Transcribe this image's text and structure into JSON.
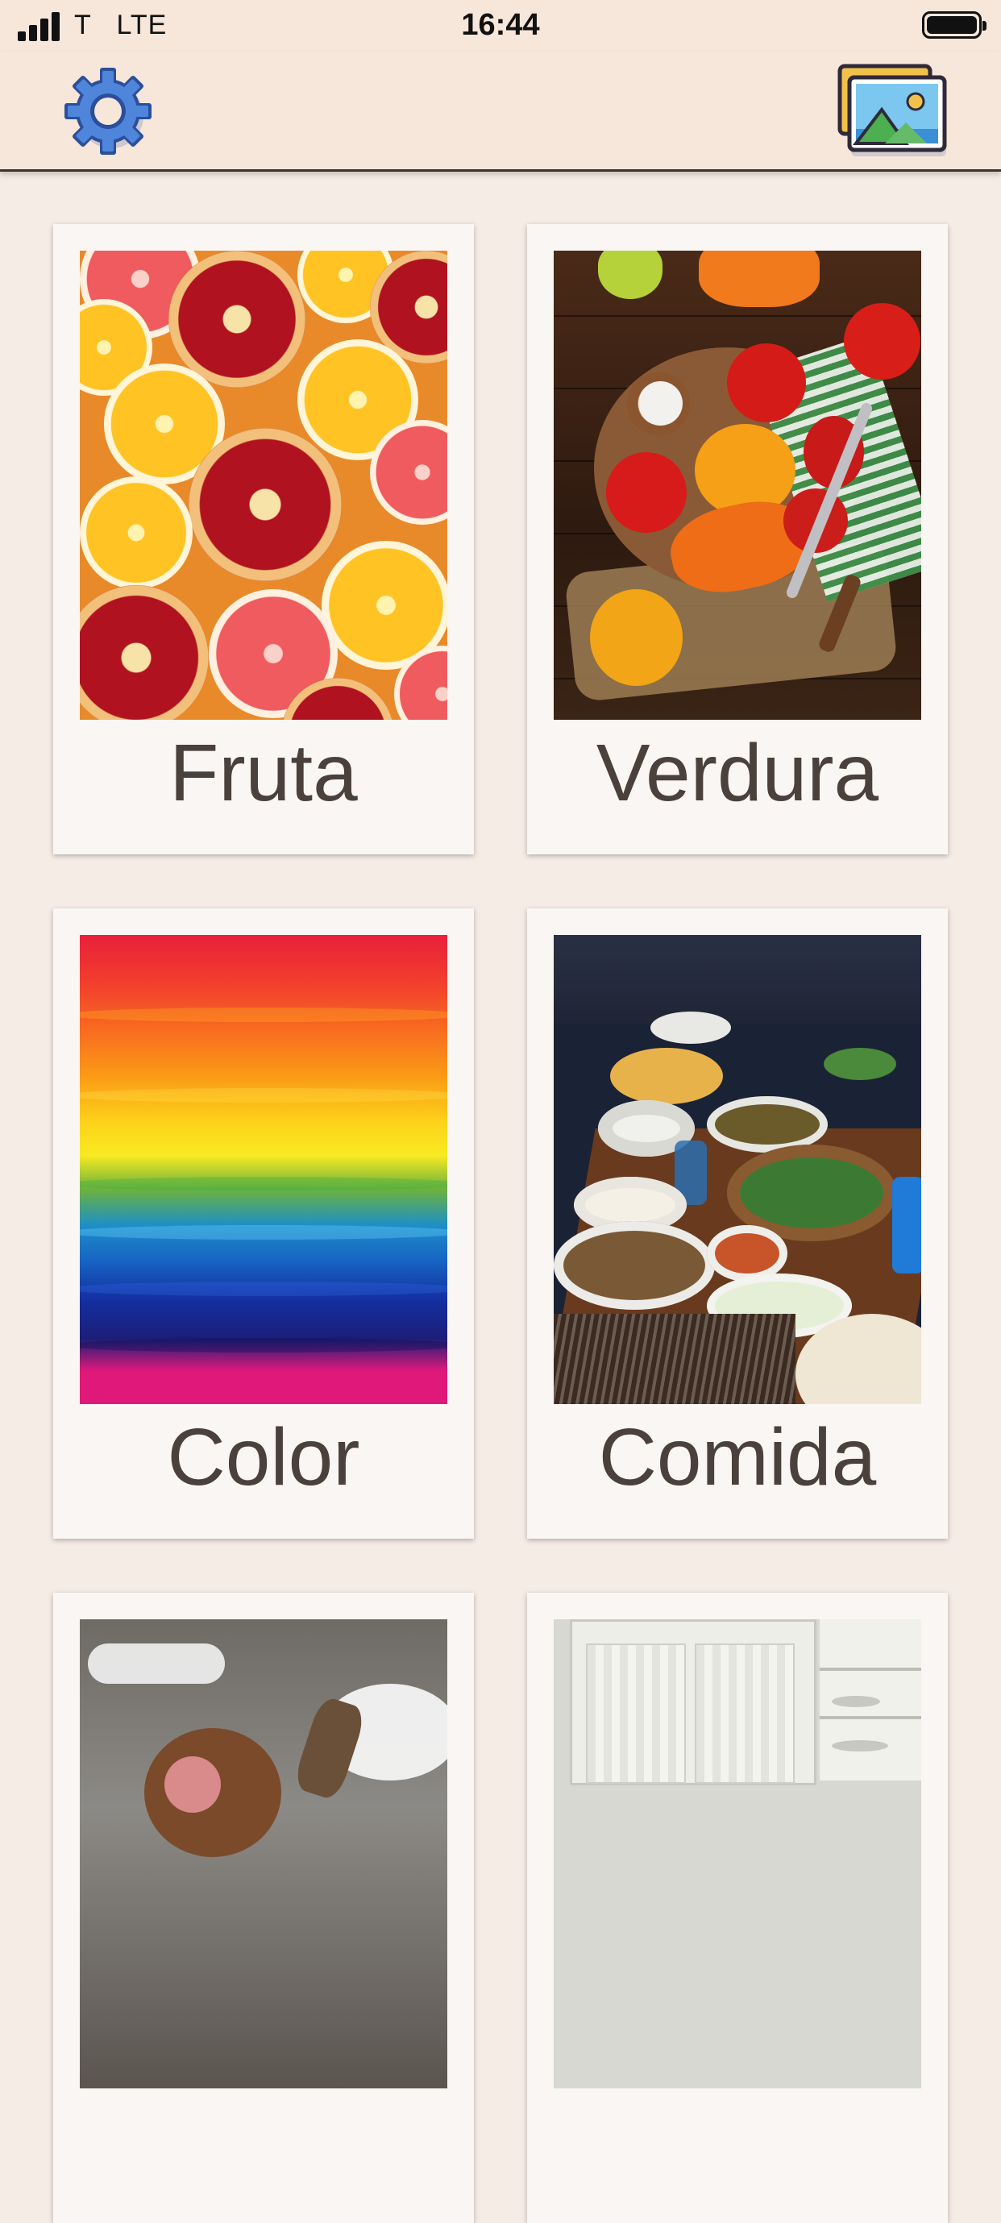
{
  "status_bar": {
    "carrier": "T   LTE",
    "time": "16:44"
  },
  "toolbar": {
    "settings_icon": "gear-icon",
    "gallery_icon": "photo-gallery-icon"
  },
  "categories": [
    {
      "label": "Fruta",
      "image": "citrus-and-pomegranate-photo"
    },
    {
      "label": "Verdura",
      "image": "peppers-and-tomatoes-photo"
    },
    {
      "label": "Color",
      "image": "rainbow-paint-photo"
    },
    {
      "label": "Comida",
      "image": "food-buffet-photo"
    },
    {
      "label": "",
      "image": "monkey-photo"
    },
    {
      "label": "",
      "image": "kitchen-cabinet-photo"
    }
  ],
  "colors": {
    "header_background": "#f7e6da",
    "page_background": "#f6ece6",
    "card_background": "#f9f6f3",
    "label_text": "#4a403c",
    "gear_blue": "#3f6fc4"
  }
}
